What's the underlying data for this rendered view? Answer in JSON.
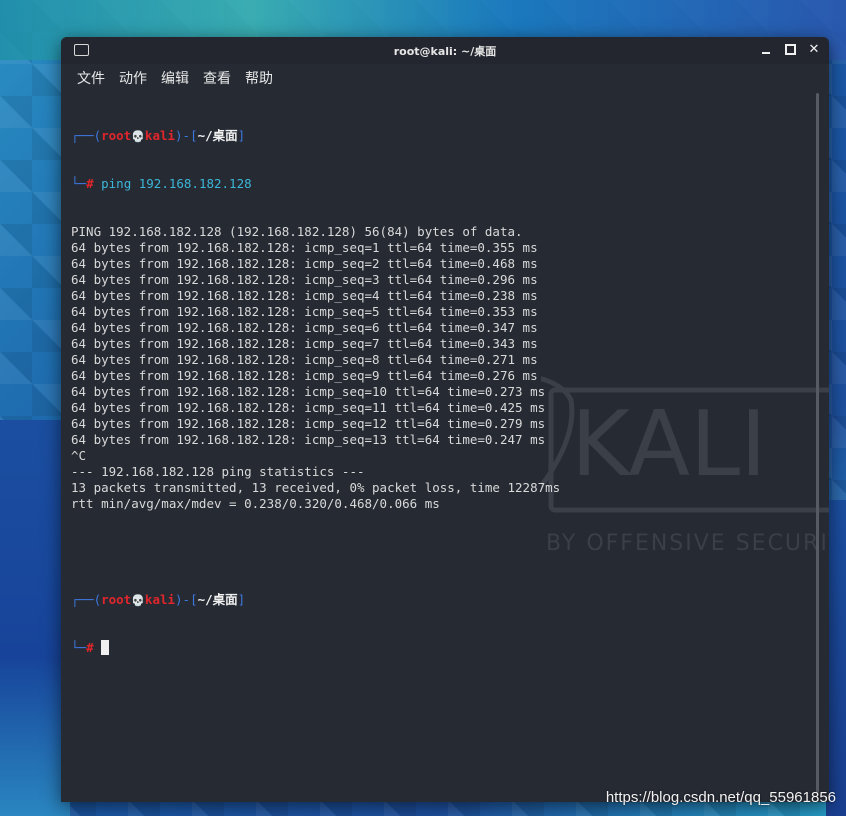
{
  "window": {
    "title": "root@kali: ~/桌面"
  },
  "menu": [
    "文件",
    "动作",
    "编辑",
    "查看",
    "帮助"
  ],
  "prompt": {
    "open": "┌──(",
    "user": "root",
    "skull": "💀",
    "host": "kali",
    "mid": ")-[",
    "path": "~/桌面",
    "close": "]",
    "hash_prefix": "└─",
    "hash": "#"
  },
  "command": "ping 192.168.182.128",
  "output": [
    "PING 192.168.182.128 (192.168.182.128) 56(84) bytes of data.",
    "64 bytes from 192.168.182.128: icmp_seq=1 ttl=64 time=0.355 ms",
    "64 bytes from 192.168.182.128: icmp_seq=2 ttl=64 time=0.468 ms",
    "64 bytes from 192.168.182.128: icmp_seq=3 ttl=64 time=0.296 ms",
    "64 bytes from 192.168.182.128: icmp_seq=4 ttl=64 time=0.238 ms",
    "64 bytes from 192.168.182.128: icmp_seq=5 ttl=64 time=0.353 ms",
    "64 bytes from 192.168.182.128: icmp_seq=6 ttl=64 time=0.347 ms",
    "64 bytes from 192.168.182.128: icmp_seq=7 ttl=64 time=0.343 ms",
    "64 bytes from 192.168.182.128: icmp_seq=8 ttl=64 time=0.271 ms",
    "64 bytes from 192.168.182.128: icmp_seq=9 ttl=64 time=0.276 ms",
    "64 bytes from 192.168.182.128: icmp_seq=10 ttl=64 time=0.273 ms",
    "64 bytes from 192.168.182.128: icmp_seq=11 ttl=64 time=0.425 ms",
    "64 bytes from 192.168.182.128: icmp_seq=12 ttl=64 time=0.279 ms",
    "64 bytes from 192.168.182.128: icmp_seq=13 ttl=64 time=0.247 ms",
    "^C",
    "--- 192.168.182.128 ping statistics ---",
    "13 packets transmitted, 13 received, 0% packet loss, time 12287ms",
    "rtt min/avg/max/mdev = 0.238/0.320/0.468/0.066 ms"
  ],
  "watermark": {
    "logo": "KALI",
    "tagline": "BY OFFENSIVE SECURITY"
  },
  "footer_url": "https://blog.csdn.net/qq_55961856",
  "colors": {
    "terminal_bg": "#262a33",
    "prompt_blue": "#3d78e0",
    "prompt_red": "#e0262b",
    "command_cyan": "#3cb6d8"
  }
}
